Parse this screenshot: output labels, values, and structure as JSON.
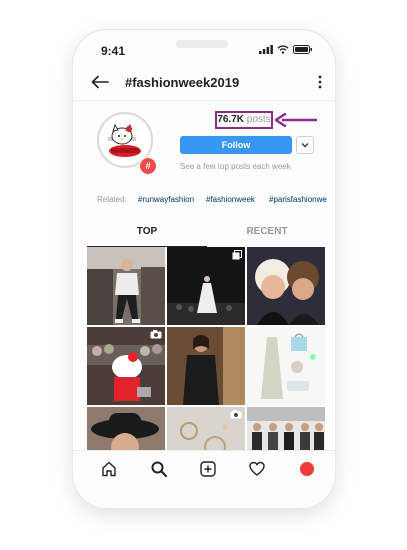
{
  "status_bar": {
    "time": "9:41"
  },
  "header": {
    "title": "#fashionweek2019"
  },
  "profile": {
    "posts_count": "76.7K",
    "posts_label": "posts",
    "follow_label": "Follow",
    "subtext": "See a few top posts each week"
  },
  "related": {
    "label": "Related:",
    "tags": [
      "#runwayfashion",
      "#fashionweek",
      "#parisfashionwe"
    ]
  },
  "tabs": [
    {
      "label": "TOP"
    },
    {
      "label": "RECENT"
    }
  ],
  "grid": {
    "tiles": [
      {
        "name": "post-street-style",
        "overlay": ""
      },
      {
        "name": "post-runway-gown",
        "overlay": "multi-photo"
      },
      {
        "name": "post-selfie",
        "overlay": ""
      },
      {
        "name": "post-hello-kitty-audience",
        "overlay": "video"
      },
      {
        "name": "post-model-coat",
        "overlay": ""
      },
      {
        "name": "post-accessories-flatlay",
        "overlay": ""
      },
      {
        "name": "post-woman-hat",
        "overlay": ""
      },
      {
        "name": "post-jewelry",
        "overlay": "video"
      },
      {
        "name": "post-runway-lineup",
        "overlay": ""
      }
    ]
  },
  "bottom_nav": [
    "home-icon",
    "search-icon",
    "new-post-icon",
    "activity-heart-icon",
    "profile-avatar-icon"
  ],
  "colors": {
    "follow_blue": "#3897f0",
    "annotation_purple": "#8b2c8f",
    "badge_red": "#ef4b4b",
    "hashtag_blue": "#003569"
  }
}
